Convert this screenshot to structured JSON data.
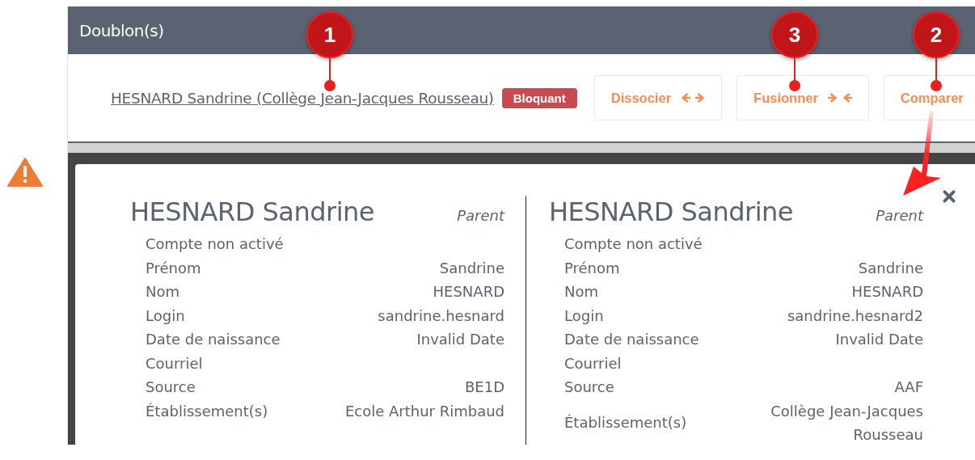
{
  "panel": {
    "title": "Doublon(s)"
  },
  "duplicate": {
    "link": "HESNARD Sandrine (Collège Jean-Jacques Rousseau)",
    "badge": "Bloquant"
  },
  "buttons": [
    {
      "label": "Dissocier",
      "kind": "split"
    },
    {
      "label": "Fusionner",
      "kind": "merge"
    },
    {
      "label": "Comparer",
      "kind": "plain"
    }
  ],
  "callouts": [
    {
      "number": "1"
    },
    {
      "number": "3"
    },
    {
      "number": "2"
    }
  ],
  "modal": {
    "records": [
      {
        "name": "HESNARD Sandrine",
        "role": "Parent",
        "status": "Compte non activé",
        "fields": [
          {
            "label": "Prénom",
            "value": "Sandrine"
          },
          {
            "label": "Nom",
            "value": "HESNARD"
          },
          {
            "label": "Login",
            "value": "sandrine.hesnard"
          },
          {
            "label": "Date de naissance",
            "value": "Invalid Date"
          },
          {
            "label": "Courriel"
          },
          {
            "label": "Source",
            "value": "BE1D"
          },
          {
            "label": "Établissement(s)",
            "value": "Ecole Arthur Rimbaud"
          }
        ]
      },
      {
        "name": "HESNARD Sandrine",
        "role": "Parent",
        "status": "Compte non activé",
        "fields": [
          {
            "label": "Prénom",
            "value": "Sandrine"
          },
          {
            "label": "Nom",
            "value": "HESNARD"
          },
          {
            "label": "Login",
            "value": "sandrine.hesnard2"
          },
          {
            "label": "Date de naissance",
            "value": "Invalid Date"
          },
          {
            "label": "Courriel"
          },
          {
            "label": "Source",
            "value": "AAF"
          },
          {
            "label": "Établissement(s)",
            "value": "Collège Jean-Jacques Rousseau"
          }
        ]
      }
    ]
  }
}
